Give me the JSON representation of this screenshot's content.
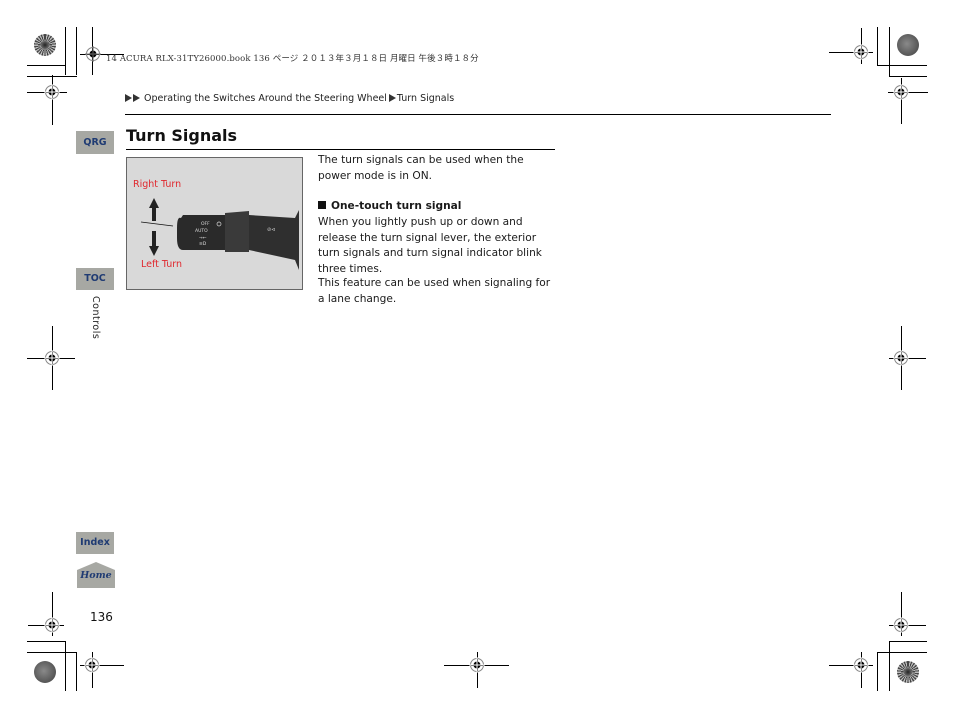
{
  "print_header": {
    "text": "14 ACURA RLX-31TY26000.book  136 ページ  ２０１３年３月１８日  月曜日  午後３時１８分"
  },
  "breadcrumb": {
    "items": [
      "Operating the Switches Around the Steering Wheel",
      "Turn Signals"
    ]
  },
  "side_nav": {
    "qrg": "QRG",
    "toc": "TOC",
    "section": "Controls",
    "index": "Index",
    "home": "Home"
  },
  "page": {
    "title": "Turn Signals",
    "number": "136"
  },
  "figure": {
    "label_up": "Right Turn",
    "label_down": "Left Turn",
    "lever_marks": [
      "OFF",
      "AUTO",
      "→←",
      "≡D"
    ],
    "label_color": "#e0282e"
  },
  "content": {
    "intro": "The turn signals can be used when the power mode is in ON.",
    "subheading": "One-touch turn signal",
    "paragraph1": "When you lightly push up or down and release the turn signal lever, the exterior turn signals and turn signal indicator blink three times.",
    "paragraph2": "This feature can be used when signaling for a lane change."
  },
  "colors": {
    "nav_tab_bg": "#a7a8a3",
    "nav_tab_text": "#1f3b73"
  }
}
